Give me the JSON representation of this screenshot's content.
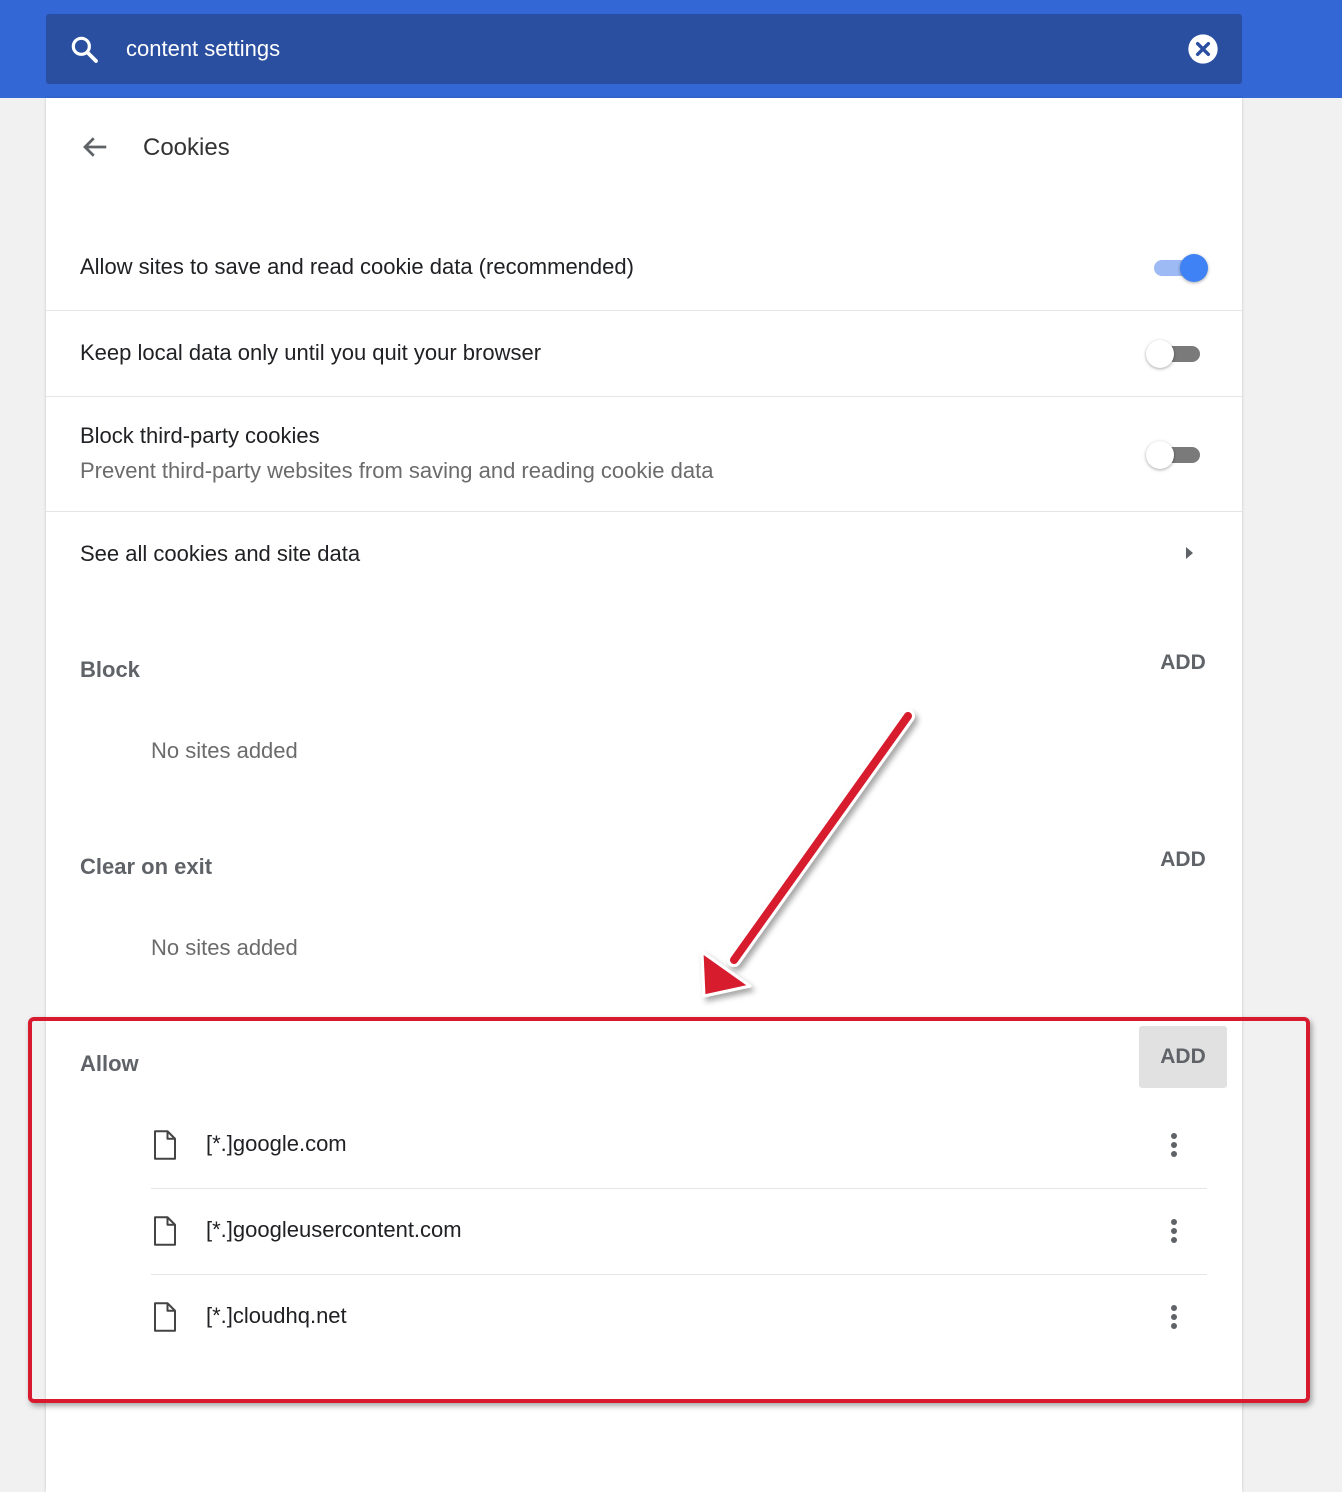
{
  "search": {
    "value": "content settings"
  },
  "page": {
    "title": "Cookies"
  },
  "settings": {
    "allow_cookies": {
      "label": "Allow sites to save and read cookie data (recommended)",
      "state": "on"
    },
    "keep_local": {
      "label": "Keep local data only until you quit your browser",
      "state": "off"
    },
    "block_third_party": {
      "label": "Block third-party cookies",
      "sublabel": "Prevent third-party websites from saving and reading cookie data",
      "state": "off"
    },
    "see_all": {
      "label": "See all cookies and site data"
    }
  },
  "sections": {
    "block": {
      "heading": "Block",
      "add_label": "ADD",
      "empty_text": "No sites added"
    },
    "clear_on_exit": {
      "heading": "Clear on exit",
      "add_label": "ADD",
      "empty_text": "No sites added"
    },
    "allow": {
      "heading": "Allow",
      "add_label": "ADD",
      "sites": [
        {
          "label": "[*.]google.com"
        },
        {
          "label": "[*.]googleusercontent.com"
        },
        {
          "label": "[*.]cloudhq.net"
        }
      ]
    }
  },
  "colors": {
    "header_blue": "#3367d6",
    "search_bg": "#2a4fa0",
    "toggle_on": "#3f82f5",
    "annotation_red": "#d71a2d"
  },
  "icons": [
    "search-icon",
    "clear-icon",
    "back-arrow-icon",
    "chevron-right-icon",
    "file-icon",
    "more-vert-icon"
  ]
}
